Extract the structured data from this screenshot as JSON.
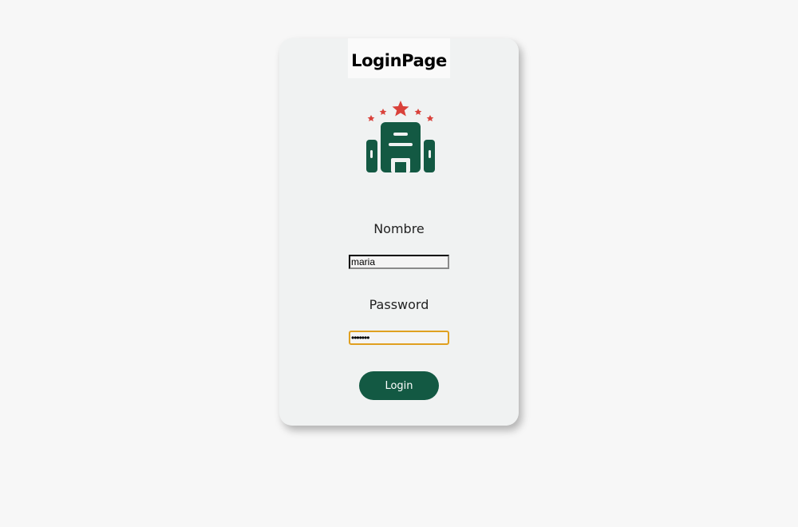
{
  "card": {
    "title": "LoginPage",
    "logo_icon": "hotel-building-icon",
    "colors": {
      "logo_building": "#135943",
      "logo_stars": "#d9413a",
      "button_bg": "#135943",
      "focus_border": "#e0a020"
    }
  },
  "form": {
    "nombre": {
      "label": "Nombre",
      "value": "maria"
    },
    "password": {
      "label": "Password",
      "value": "•••••••"
    },
    "submit_label": "Login"
  }
}
